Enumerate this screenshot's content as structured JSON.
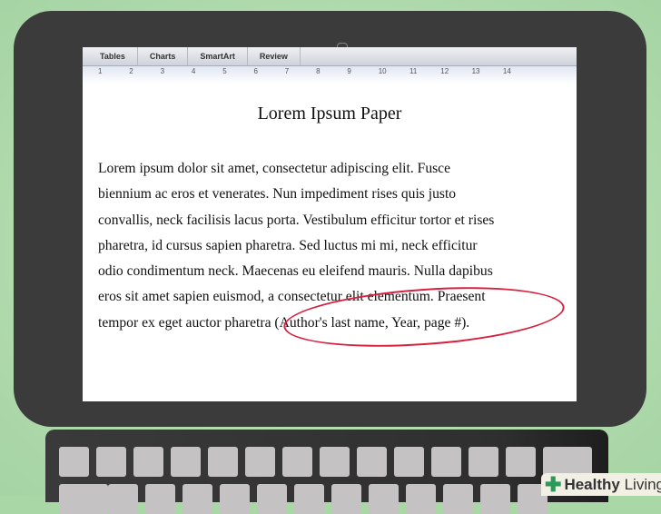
{
  "toolbar": {
    "tabs": [
      "Tables",
      "Charts",
      "SmartArt",
      "Review"
    ]
  },
  "ruler": {
    "marks": [
      "1",
      "2",
      "3",
      "4",
      "5",
      "6",
      "7",
      "8",
      "9",
      "10",
      "11",
      "12",
      "13",
      "14"
    ]
  },
  "document": {
    "title": "Lorem Ipsum Paper",
    "lines": [
      "Lorem ipsum dolor sit amet, consectetur adipiscing elit. Fusce",
      "biennium ac eros et venerates. Nun impediment rises quis justo",
      "convallis, neck facilisis lacus porta. Vestibulum efficitur tortor et rises",
      "pharetra, id cursus sapien pharetra. Sed luctus mi mi, neck efficitur",
      "odio condimentum neck. Maecenas eu eleifend mauris. Nulla dapibus",
      "eros sit amet sapien euismod, a consectetur elit elementum. Praesent",
      "tempor ex eget auctor pharetra (Author's last name, Year, page #)."
    ],
    "highlight_color": "#d8203f"
  },
  "watermark": {
    "brand": "Healthy",
    "suffix": "Living"
  }
}
